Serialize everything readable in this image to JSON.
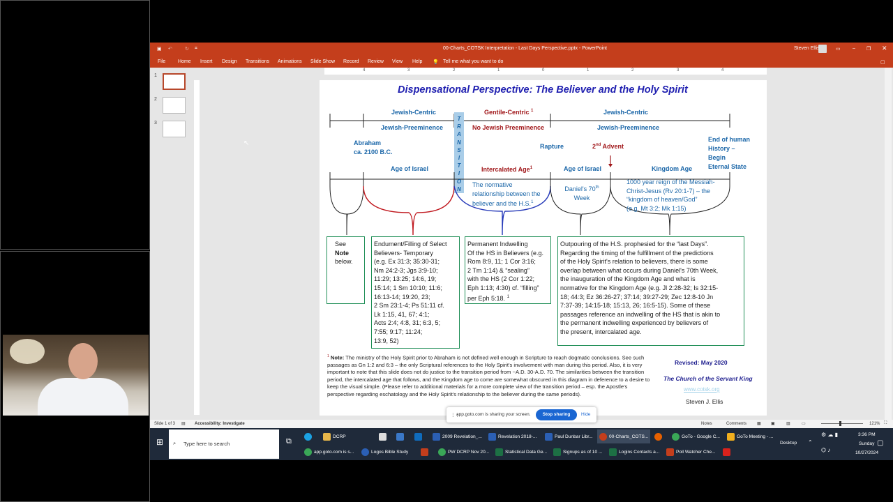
{
  "app": {
    "title": "00-Charts_COTSK Interpretation - Last Days Perspective.pptx - PowerPoint",
    "user": "Steven Ellis",
    "tabs": [
      "File",
      "Home",
      "Insert",
      "Design",
      "Transitions",
      "Animations",
      "Slide Show",
      "Record",
      "Review",
      "View",
      "Help"
    ],
    "tell_me": "Tell me what you want to do",
    "ruler_marks": [
      "4",
      "3",
      "2",
      "1",
      "0",
      "1",
      "2",
      "3",
      "4"
    ],
    "slide_numbers": [
      "1",
      "2",
      "3"
    ],
    "status_left": "Slide 1 of 3",
    "accessibility": "Accessibility: Investigate",
    "notes": "Notes",
    "comments": "Comments",
    "zoom": "121%"
  },
  "slide": {
    "title": "Dispensational Perspective:  The Believer and the Holy Spirit",
    "jewish_centric_1": "Jewish-Centric",
    "gentile_centric": "Gentile-Centric",
    "gentile_sup": "1",
    "jewish_centric_2": "Jewish-Centric",
    "jewish_pre_1": "Jewish-Preeminence",
    "no_jewish_pre": "No Jewish Preeminence",
    "jewish_pre_2": "Jewish-Preeminence",
    "transition_letters": [
      "T",
      "R",
      "A",
      "N",
      "S",
      "I",
      "T",
      "I",
      "O",
      "N"
    ],
    "abraham": "Abraham",
    "abraham_date": "ca.  2100 B.C.",
    "rapture": "Rapture",
    "second_advent_num": "2",
    "second_advent_sup": "nd",
    "second_advent_word": " Advent",
    "end_history": [
      "End of human",
      "History –",
      "Begin",
      "Eternal State"
    ],
    "age_israel_1": "Age of Israel",
    "intercalated": "Intercalated Age",
    "intercalated_sup": "1",
    "age_israel_2": "Age of Israel",
    "kingdom_age": "Kingdom Age",
    "normative": [
      "The normative",
      "relationship between the",
      "believer and the H.S."
    ],
    "normative_sup": "1",
    "daniels_1": "Daniel's 70",
    "daniels_sup": "th",
    "daniels_2": "Week",
    "millennium": [
      "1000 year reign of the Messiah-",
      "Christ-Jesus (Rv 20:1-7) – the",
      "“kingdom of heaven/God”",
      "(e.g. Mt 3:2; Mk 1:15)"
    ],
    "box1": [
      "See",
      "Note",
      "below."
    ],
    "box2": [
      "Endument/Filling of Select",
      "Believers- Temporary",
      "(e.g. Ex 31:3; 35:30-31;",
      "Nm 24:2-3; Jgs 3:9-10;",
      "11:29; 13:25; 14:6, 19;",
      "15:14; 1 Sm 10:10; 11:6;",
      "16:13-14; 19:20, 23;",
      "2 Sm 23:1-4; Ps 51:11 cf.",
      "Lk 1:15, 41, 67; 4:1;",
      "Acts 2:4; 4:8, 31; 6:3, 5;",
      "7:55; 9:17; 11:24;",
      "13:9, 52)"
    ],
    "box3": [
      "Permanent Indwelling",
      "Of the HS in Believers (e.g.",
      "Rom 8:9, 11; 1 Cor 3:16;",
      "2 Tm 1:14)  & “sealing”",
      "with the HS (2 Cor 1:22;",
      "Eph 1:13; 4:30) cf. “filling”",
      "per Eph 5:18."
    ],
    "box3_sup": "1",
    "box4": [
      "Outpouring of the H.S. prophesied for the “last Days”.",
      "Regarding the timing of the fulfillment of the predictions",
      "of the Holy Spirit's relation to believers, there is some",
      "overlap between what occurs during  Daniel's 70th Week,",
      "the inauguration of the Kingdom Age and what is",
      "normative for the Kingdom Age (e.g. Jl 2:28-32; Is 32:15-",
      "18; 44:3; Ez 36:26-27; 37:14; 39:27-29; Zec 12:8-10 Jn",
      "7:37-39; 14:15-18; 15:13, 26; 16:5-15).  Some of these",
      "passages reference an indwelling of the HS that is akin to",
      "the permanent indwelling experienced by believers of",
      "the present, intercalated age."
    ],
    "note_sup": "1",
    "note_label": " Note:",
    "note_text": " The ministry of the Holy Spirit prior to Abraham is not defined well enough in Scripture  to reach dogmatic conclusions. See  such passages as Gn 1:2 and 6:3 – the only Scriptural references to the Holy Spirit's involvement with man during  this period.  Also, it is very important to note that this slide does not do justice to the transition period from ~A.D. 30-A.D. 70.  The similarities between the transition period, the intercalated age that follows, and the Kingdom age to come are somewhat obscured in this diagram in deference to a desire to keep the visual simple.  (Please refer to additional materials for a more complete view of the transition period – esp. the Apostle's perspective regarding eschatology and the Holy Spirit's relationship to the believer during the same periods).",
    "revised": "Revised:  May 2020",
    "church": "The Church of the Servant King",
    "website": "www.cotsk.org",
    "author": "Steven J.  Ellis"
  },
  "share": {
    "text": "app.goto.com is sharing your screen.",
    "stop": "Stop sharing",
    "hide": "Hide"
  },
  "taskbar": {
    "search": "Type here to search",
    "row1": [
      "DCRP",
      "2009 Revelation_...",
      "Revelation 2018-...",
      "Paul Dunbar Libr...",
      "00-Charts_COTS...",
      "GoTo - Google C...",
      "GoTo Meeting - ..."
    ],
    "row2": [
      "app.goto.com is s...",
      "Logos Bible Study",
      "PW DCRP Nov 20...",
      "Statistical Data Ge...",
      "Signups as of 10 ...",
      "Logins Contacts a...",
      "Poll Watcher Che..."
    ],
    "desktop": "Desktop",
    "time": "3:36 PM",
    "day": "Sunday",
    "date": "10/27/2024"
  },
  "colors": {
    "ppt_red": "#c43e1c",
    "slide_blue": "#1a66a8",
    "slide_red": "#a1181b",
    "box_green": "#1e8e56",
    "transition_fill": "#a9cde8",
    "stop_blue": "#1a66d2"
  }
}
